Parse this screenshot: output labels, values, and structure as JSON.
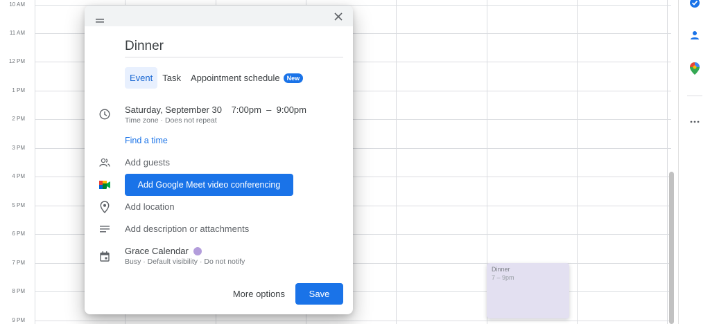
{
  "calendar": {
    "time_labels": [
      "10 AM",
      "11 AM",
      "12 PM",
      "1 PM",
      "2 PM",
      "3 PM",
      "4 PM",
      "5 PM",
      "6 PM",
      "7 PM",
      "8 PM",
      "9 PM"
    ],
    "event_chip": {
      "title": "Dinner",
      "time": "7 – 9pm",
      "color": "#e3e0f1"
    }
  },
  "dialog": {
    "title_value": "Dinner",
    "tabs": [
      {
        "label": "Event",
        "active": true
      },
      {
        "label": "Task",
        "active": false
      },
      {
        "label": "Appointment schedule",
        "badge": "New",
        "active": false
      }
    ],
    "date": "Saturday, September 30",
    "time_range": "7:00pm  –  9:00pm",
    "time_sub": "Time zone · Does not repeat",
    "find_time": "Find a time",
    "add_guests": "Add guests",
    "meet_button": "Add Google Meet video conferencing",
    "add_location": "Add location",
    "add_description": "Add description or attachments",
    "calendar_name": "Grace Calendar",
    "calendar_color": "#b39ddb",
    "calendar_sub": "Busy · Default visibility · Do not notify",
    "more_options": "More options",
    "save": "Save",
    "accent_color": "#1a73e8"
  },
  "side_panel": {
    "icons": [
      "tasks-icon",
      "contacts-icon",
      "maps-icon",
      "more-icon"
    ]
  }
}
